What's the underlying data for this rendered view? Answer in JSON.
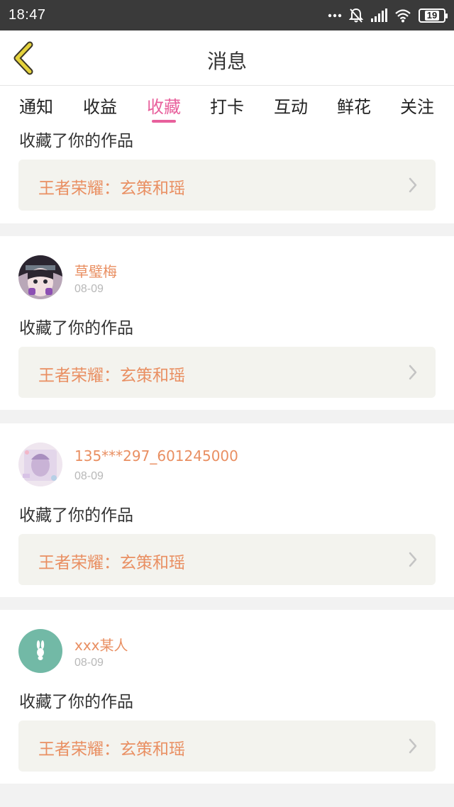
{
  "status_bar": {
    "time": "18:47",
    "battery": "19",
    "icons": [
      "dots-icon",
      "mute-bell-icon",
      "signal-icon",
      "wifi-icon",
      "battery-icon"
    ]
  },
  "header": {
    "title": "消息",
    "back_icon": "chevron-left-icon",
    "accent_color": "#d9c435"
  },
  "tabs": [
    {
      "label": "通知",
      "active": false
    },
    {
      "label": "收益",
      "active": false
    },
    {
      "label": "收藏",
      "active": true
    },
    {
      "label": "打卡",
      "active": false
    },
    {
      "label": "互动",
      "active": false
    },
    {
      "label": "鲜花",
      "active": false
    },
    {
      "label": "关注",
      "active": false
    }
  ],
  "colors": {
    "active_tab": "#e8609c",
    "username": "#e98f62",
    "work_title": "#e98f62",
    "date": "#b8b8b8",
    "card_inner_bg": "#f3f3ee"
  },
  "messages": [
    {
      "action": "收藏了你的作品",
      "work_title": "王者荣耀：玄策和瑶"
    },
    {
      "username": "草璧梅",
      "date": "08-09",
      "action": "收藏了你的作品",
      "work_title": "王者荣耀：玄策和瑶",
      "avatar": "anime-girl-avatar"
    },
    {
      "username": "135***297_601245000",
      "date": "08-09",
      "action": "收藏了你的作品",
      "work_title": "王者荣耀：玄策和瑶",
      "avatar": "pastel-drawing-avatar"
    },
    {
      "username": "xxx某人",
      "date": "08-09",
      "action": "收藏了你的作品",
      "work_title": "王者荣耀：玄策和瑶",
      "avatar": "rabbit-avatar"
    }
  ]
}
